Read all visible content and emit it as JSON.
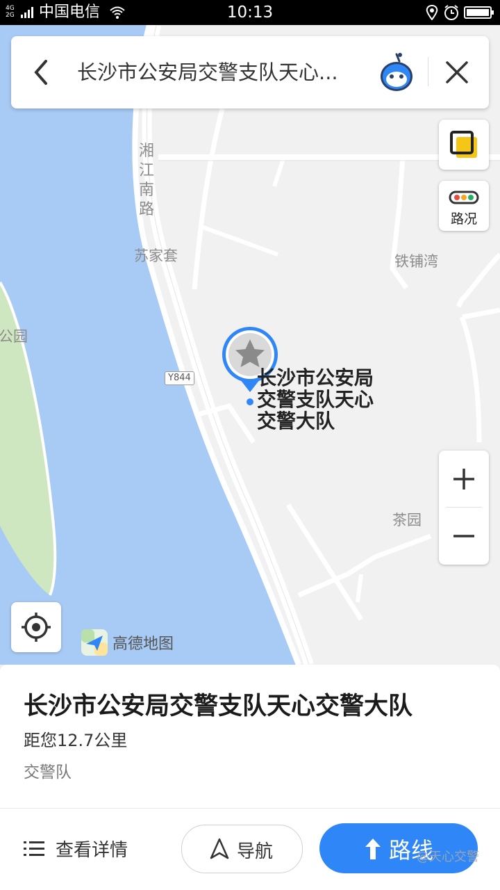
{
  "status_bar": {
    "signal": "4G\n2G",
    "carrier": "中国电信",
    "time": "10:13"
  },
  "search": {
    "query": "长沙市公安局交警支队天心..."
  },
  "map": {
    "road_label": "湘江南路",
    "places": [
      "苏家套",
      "铁铺湾",
      "茶园",
      "公园"
    ],
    "road_badge": "Y844",
    "poi_name": "长沙市公安局\n交警支队天心\n交警大队",
    "brand": "高德地图",
    "colors": {
      "water": "#a8cbf5",
      "green": "#cfe7c1",
      "land": "#f1f1f1",
      "pin": "#2f86f6"
    }
  },
  "controls": {
    "traffic_label": "路况",
    "zoom_in": "+",
    "zoom_out": "−"
  },
  "panel": {
    "title": "长沙市公安局交警支队天心交警大队",
    "distance": "距您12.7公里",
    "category": "交警队",
    "detail_label": "查看详情",
    "nav_label": "导航",
    "route_label": "路线"
  },
  "watermark": "@天心交警"
}
